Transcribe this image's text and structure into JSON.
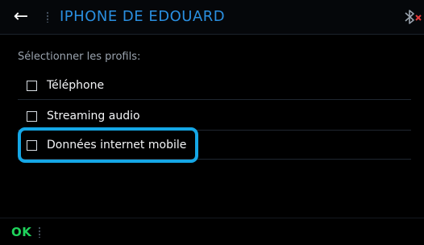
{
  "header": {
    "back_icon": "arrow-left-icon",
    "title": "IPHONE DE EDOUARD",
    "status_icon": "bluetooth-disconnected-icon",
    "title_color": "#2a8fe0",
    "status_x_color": "#e23a3a"
  },
  "main": {
    "prompt": "Sélectionner les profils:",
    "profiles": [
      {
        "label": "Téléphone",
        "checked": false
      },
      {
        "label": "Streaming audio",
        "checked": false
      },
      {
        "label": "Données internet mobile",
        "checked": false,
        "focused": true
      }
    ],
    "focus_color": "#15a7e6"
  },
  "footer": {
    "ok_label": "OK",
    "ok_color": "#1fd35b"
  }
}
